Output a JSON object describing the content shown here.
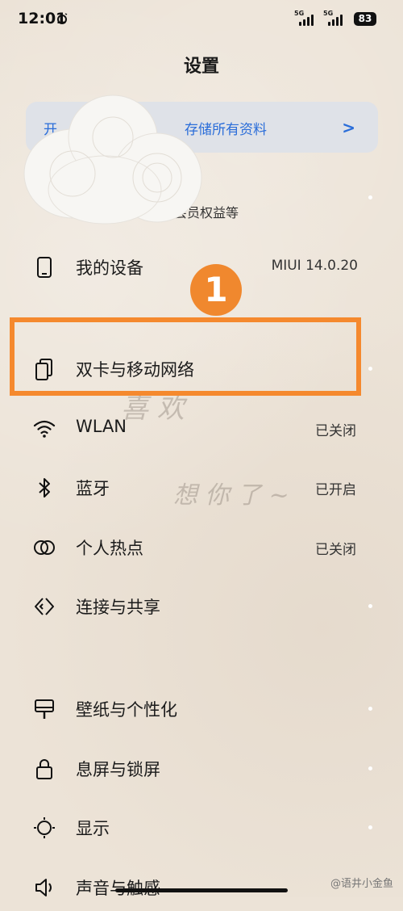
{
  "status_bar": {
    "time": "12:01",
    "signal1_type": "5G",
    "signal2_type": "5G",
    "battery": "83"
  },
  "header": {
    "title": "设置"
  },
  "account": {
    "banner_prefix": "开",
    "banner_text": "存储所有资料",
    "sub_prefix": "",
    "sub_text": "、会员权益等"
  },
  "marker": {
    "number": "1"
  },
  "settings": [
    {
      "icon": "phone-icon",
      "label": "我的设备",
      "value": "MIUI 14.0.20"
    },
    {
      "icon": "dual-sim-icon",
      "label": "双卡与移动网络",
      "value": ""
    },
    {
      "icon": "wifi-icon",
      "label": "WLAN",
      "value": "已关闭"
    },
    {
      "icon": "bluetooth-icon",
      "label": "蓝牙",
      "value": "已开启"
    },
    {
      "icon": "hotspot-icon",
      "label": "个人热点",
      "value": "已关闭"
    },
    {
      "icon": "connection-share-icon",
      "label": "连接与共享",
      "value": ""
    },
    {
      "icon": "wallpaper-icon",
      "label": "壁纸与个性化",
      "value": ""
    },
    {
      "icon": "lock-icon",
      "label": "息屏与锁屏",
      "value": ""
    },
    {
      "icon": "display-icon",
      "label": "显示",
      "value": ""
    },
    {
      "icon": "sound-icon",
      "label": "声音与触感",
      "value": ""
    }
  ],
  "watermark": "@语井小金鱼",
  "colors": {
    "accent": "#2a6dd9",
    "highlight": "#f5892e"
  }
}
